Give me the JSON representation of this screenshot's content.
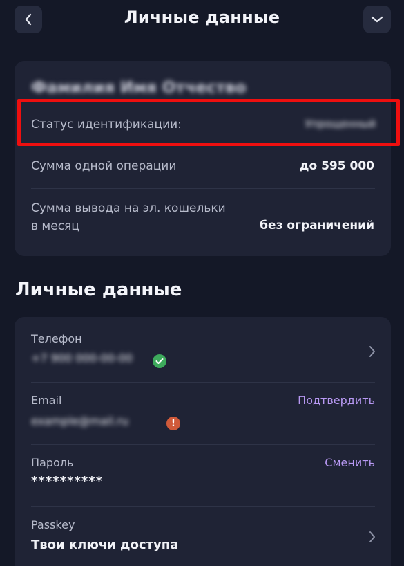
{
  "header": {
    "title": "Личные данные",
    "back_icon": "chevron-left-icon",
    "menu_icon": "chevron-down-icon"
  },
  "status_card": {
    "owner_name": "Фамилия Имя Отчество",
    "identification": {
      "label": "Статус идентификации:",
      "value": "Упрощенный"
    },
    "single_operation": {
      "label": "Сумма одной операции",
      "value": "до 595 000"
    },
    "wallet_withdrawal": {
      "label_line1": "Сумма вывода на эл. кошельки",
      "label_line2": "в месяц",
      "value": "без ограничений"
    }
  },
  "personal_section": {
    "heading": "Личные данные",
    "phone": {
      "label": "Телефон",
      "value": "+7 900 000-00-00",
      "status": "verified",
      "status_icon": "check-icon"
    },
    "email": {
      "label": "Email",
      "value": "example@mail.ru",
      "action": "Подтвердить",
      "status": "unverified",
      "status_icon": "exclamation-icon"
    },
    "password": {
      "label": "Пароль",
      "value": "**********",
      "action": "Сменить"
    },
    "passkey": {
      "label": "Passkey",
      "value": "Твои ключи доступа"
    }
  },
  "colors": {
    "background": "#141827",
    "card": "#1f2335",
    "accent_link": "#b798f2",
    "highlight": "#ee0f0f",
    "verified": "#3daa5c",
    "warning": "#d05a3a"
  }
}
